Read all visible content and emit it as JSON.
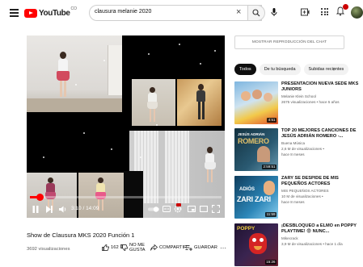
{
  "header": {
    "logo_text": "YouTube",
    "logo_country": "CO",
    "search_query": "clausura melanie 2020"
  },
  "player": {
    "time": "3:10 / 14:09",
    "progress_fraction": 0.05
  },
  "video": {
    "title": "Show de Clausura MKS 2020 Función 1",
    "views": "3692 visualizaciones",
    "likes": "162",
    "dislike_label": "NO ME GUSTA",
    "share_label": "COMPARTIR",
    "save_label": "GUARDAR"
  },
  "sidebar": {
    "chat_button": "MOSTRAR REPRODUCCIÓN DEL CHAT",
    "chips": [
      "Todos",
      "De tu búsqueda",
      "Subidas recientes"
    ],
    "recommendations": [
      {
        "title": "PRESENTACION NUEVA SEDE MKS JUNIORS",
        "channel": "Melanie Klein School",
        "stats": "2675 visualizaciones • hace 5 años",
        "duration": "4:51",
        "thumb_colors": [
          "#6ea8d8",
          "#f0c64a"
        ],
        "thumb_label": ""
      },
      {
        "title": "TOP 20 MEJORES CANCIONES DE JESÚS ADRIÁN ROMERO -...",
        "channel": "Buena Música",
        "stats": "2,6 M de visualizaciones •",
        "stats2": "hace 8 meses",
        "duration": "2:59:51",
        "thumb_colors": [
          "#1e3a4a",
          "#4a7fa0"
        ],
        "thumb_label": "ROMERO",
        "thumb_label_small": "JESÚS ADRIÁN"
      },
      {
        "title": "ZARY SE DESPIDE DE MIS PEQUEÑOS ACTORES",
        "channel": "MIS PEQUEÑOS ACTORES",
        "stats": "10 M de visualizaciones •",
        "stats2": "hace 8 meses",
        "duration": "11:59",
        "thumb_colors": [
          "#1a4d6e",
          "#3aa0d0"
        ],
        "thumb_label": "ZARI ZARI",
        "thumb_label_small": "ADIÓS"
      },
      {
        "title": "¡DESBLOQUEO a ELMO en POPPY PLAYTIME! 😨 NUNC...",
        "channel": "Mikecrack",
        "stats": "3,9 M de visualizaciones • hace 1 día",
        "duration": "15:26",
        "thumb_colors": [
          "#2a1a3a",
          "#cc2222"
        ],
        "thumb_label": "POPPY",
        "thumb_label_small": ""
      }
    ]
  },
  "icons": [
    "menu-icon",
    "search-icon",
    "mic-icon",
    "create-icon",
    "apps-icon",
    "bell-icon",
    "play-icon",
    "next-icon",
    "volume-icon",
    "autoplay-icon",
    "subtitles-icon",
    "settings-icon",
    "miniplayer-icon",
    "theater-icon",
    "fullscreen-icon",
    "like-icon",
    "dislike-icon",
    "share-icon",
    "save-icon",
    "more-icon"
  ],
  "colors": {
    "brand_red": "#ff0000",
    "text_primary": "#0f0f0f",
    "text_secondary": "#606060"
  }
}
